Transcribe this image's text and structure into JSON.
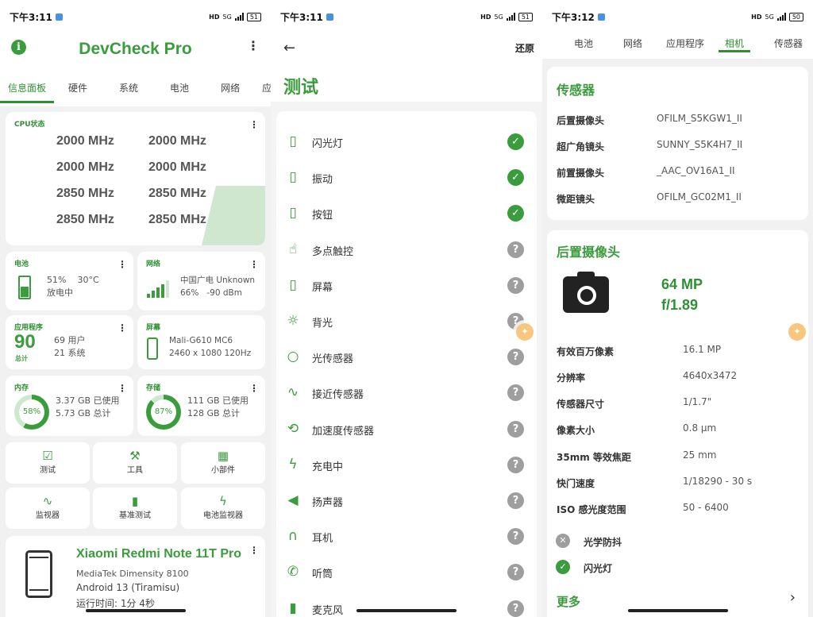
{
  "status": {
    "p1_time": "下午3:11",
    "p2_time": "下午3:11",
    "p3_time": "下午3:12",
    "network": "5G",
    "battery": "51",
    "battery3": "50"
  },
  "colors": {
    "accent": "#3b9c3e",
    "unknown": "#9e9e9e",
    "float": "#f6c77d"
  },
  "dashboard": {
    "title": "DevCheck Pro",
    "tabs": [
      "信息面板",
      "硬件",
      "系统",
      "电池",
      "网络",
      "应"
    ],
    "cpu": {
      "title": "CPU状态",
      "freqs": [
        "2000 MHz",
        "2000 MHz",
        "2000 MHz",
        "2000 MHz",
        "2850 MHz",
        "2850 MHz",
        "2850 MHz",
        "2850 MHz"
      ]
    },
    "battery": {
      "title": "电池",
      "percent": "51%",
      "temp": "30°C",
      "status": "放电中",
      "level": 0.51
    },
    "network": {
      "title": "网络",
      "operator": "中国广电 Unknown",
      "signal": "66%",
      "dbm": "-90 dBm"
    },
    "apps": {
      "title": "应用程序",
      "total": "90",
      "total_label": "总计",
      "user": "69 用户",
      "system": "21 系统"
    },
    "screen": {
      "title": "屏幕",
      "gpu": "Mali-G610 MC6",
      "res": "2460 x 1080  120Hz"
    },
    "memory": {
      "title": "内存",
      "percent": "58%",
      "used": "3.37 GB 已使用",
      "total": "5.73 GB 总计",
      "value": 0.58
    },
    "storage": {
      "title": "存储",
      "percent": "87%",
      "used": "111 GB 已使用",
      "total": "128 GB 总计",
      "value": 0.87
    },
    "tools": [
      {
        "label": "测试",
        "icon": "checklist-icon",
        "glyph": "☑"
      },
      {
        "label": "工具",
        "icon": "tools-icon",
        "glyph": "⚒"
      },
      {
        "label": "小部件",
        "icon": "widgets-icon",
        "glyph": "▦"
      },
      {
        "label": "监视器",
        "icon": "pulse-icon",
        "glyph": "∿"
      },
      {
        "label": "基准测试",
        "icon": "bar-chart-icon",
        "glyph": "▮"
      },
      {
        "label": "电池监视器",
        "icon": "bolt-icon",
        "glyph": "ϟ"
      }
    ],
    "device": {
      "name": "Xiaomi Redmi Note 11T Pro",
      "soc": "MediaTek Dimensity 8100",
      "os": "Android 13 (Tiramisu)",
      "uptime": "运行时间: 1分 4秒"
    }
  },
  "tests": {
    "title": "测试",
    "restore": "还原",
    "items": [
      {
        "label": "闪光灯",
        "icon": "flashlight-icon",
        "glyph": "▯",
        "status": "ok"
      },
      {
        "label": "振动",
        "icon": "vibration-icon",
        "glyph": "▯",
        "status": "ok"
      },
      {
        "label": "按钮",
        "icon": "phone-button-icon",
        "glyph": "▯",
        "status": "ok"
      },
      {
        "label": "多点触控",
        "icon": "touch-icon",
        "glyph": "☝",
        "status": "unknown"
      },
      {
        "label": "屏幕",
        "icon": "screen-icon",
        "glyph": "▯",
        "status": "unknown"
      },
      {
        "label": "背光",
        "icon": "brightness-icon",
        "glyph": "☼",
        "status": "unknown"
      },
      {
        "label": "光传感器",
        "icon": "lightbulb-icon",
        "glyph": "○",
        "status": "unknown"
      },
      {
        "label": "接近传感器",
        "icon": "proximity-icon",
        "glyph": "∿",
        "status": "unknown"
      },
      {
        "label": "加速度传感器",
        "icon": "rotate-icon",
        "glyph": "⟲",
        "status": "unknown"
      },
      {
        "label": "充电中",
        "icon": "bolt-icon",
        "glyph": "ϟ",
        "status": "unknown"
      },
      {
        "label": "扬声器",
        "icon": "speaker-icon",
        "glyph": "◀",
        "status": "unknown"
      },
      {
        "label": "耳机",
        "icon": "headphones-icon",
        "glyph": "∩",
        "status": "unknown"
      },
      {
        "label": "听筒",
        "icon": "phone-call-icon",
        "glyph": "✆",
        "status": "unknown"
      },
      {
        "label": "麦克风",
        "icon": "mic-icon",
        "glyph": "▮",
        "status": "unknown"
      }
    ]
  },
  "camera": {
    "tabs": [
      "电池",
      "网络",
      "应用程序",
      "相机",
      "传感器"
    ],
    "sensors": {
      "title": "传感器",
      "rows": [
        {
          "k": "后置摄像头",
          "v": "OFILM_S5KGW1_II"
        },
        {
          "k": "超广角镜头",
          "v": "SUNNY_S5K4H7_II"
        },
        {
          "k": "前置摄像头",
          "v": "_AAC_OV16A1_II"
        },
        {
          "k": "微距镜头",
          "v": "OFILM_GC02M1_II"
        }
      ]
    },
    "rear": {
      "title": "后置摄像头",
      "mp": "64 MP",
      "aperture": "f/1.89",
      "rows": [
        {
          "k": "有效百万像素",
          "v": "16.1 MP"
        },
        {
          "k": "分辨率",
          "v": "4640x3472"
        },
        {
          "k": "传感器尺寸",
          "v": "1/1.7\""
        },
        {
          "k": "像素大小",
          "v": "0.8 µm"
        },
        {
          "k": "35mm 等效焦距",
          "v": "25 mm"
        },
        {
          "k": "快门速度",
          "v": "1/18290 - 30 s"
        },
        {
          "k": "ISO 感光度范围",
          "v": "50 - 6400"
        }
      ],
      "features": [
        {
          "label": "光学防抖",
          "supported": false
        },
        {
          "label": "闪光灯",
          "supported": true
        }
      ],
      "more": "更多"
    }
  }
}
